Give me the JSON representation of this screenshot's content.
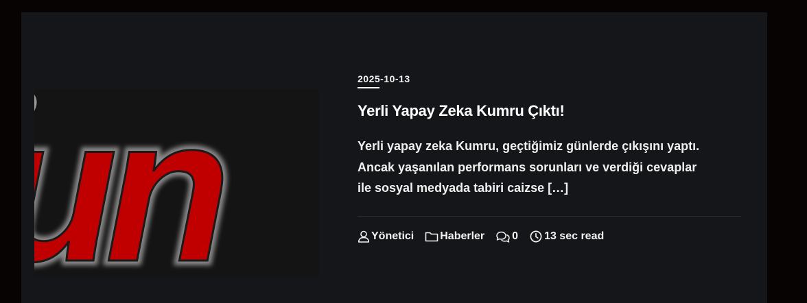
{
  "post": {
    "date": "2025-10-13",
    "title": "Yerli Yapay Zeka Kumru Çıktı!",
    "excerpt_lines": [
      "Yerli yapay zeka Kumru, geçtiğimiz günlerde çıkışını yaptı.",
      "Ancak yaşanılan performans sorunları ve verdiği cevaplar",
      "ile sosyal medyada tabiri caizse […]"
    ],
    "meta": {
      "author": "Yönetici",
      "category": "Haberler",
      "comments": "0",
      "read_time": "13 sec read"
    }
  },
  "thumbnail": {
    "logo_text": "un",
    "logo_color": "#c00000"
  },
  "colors": {
    "page_background": "#070303",
    "card_background": "#141619",
    "text": "#ffffff"
  }
}
